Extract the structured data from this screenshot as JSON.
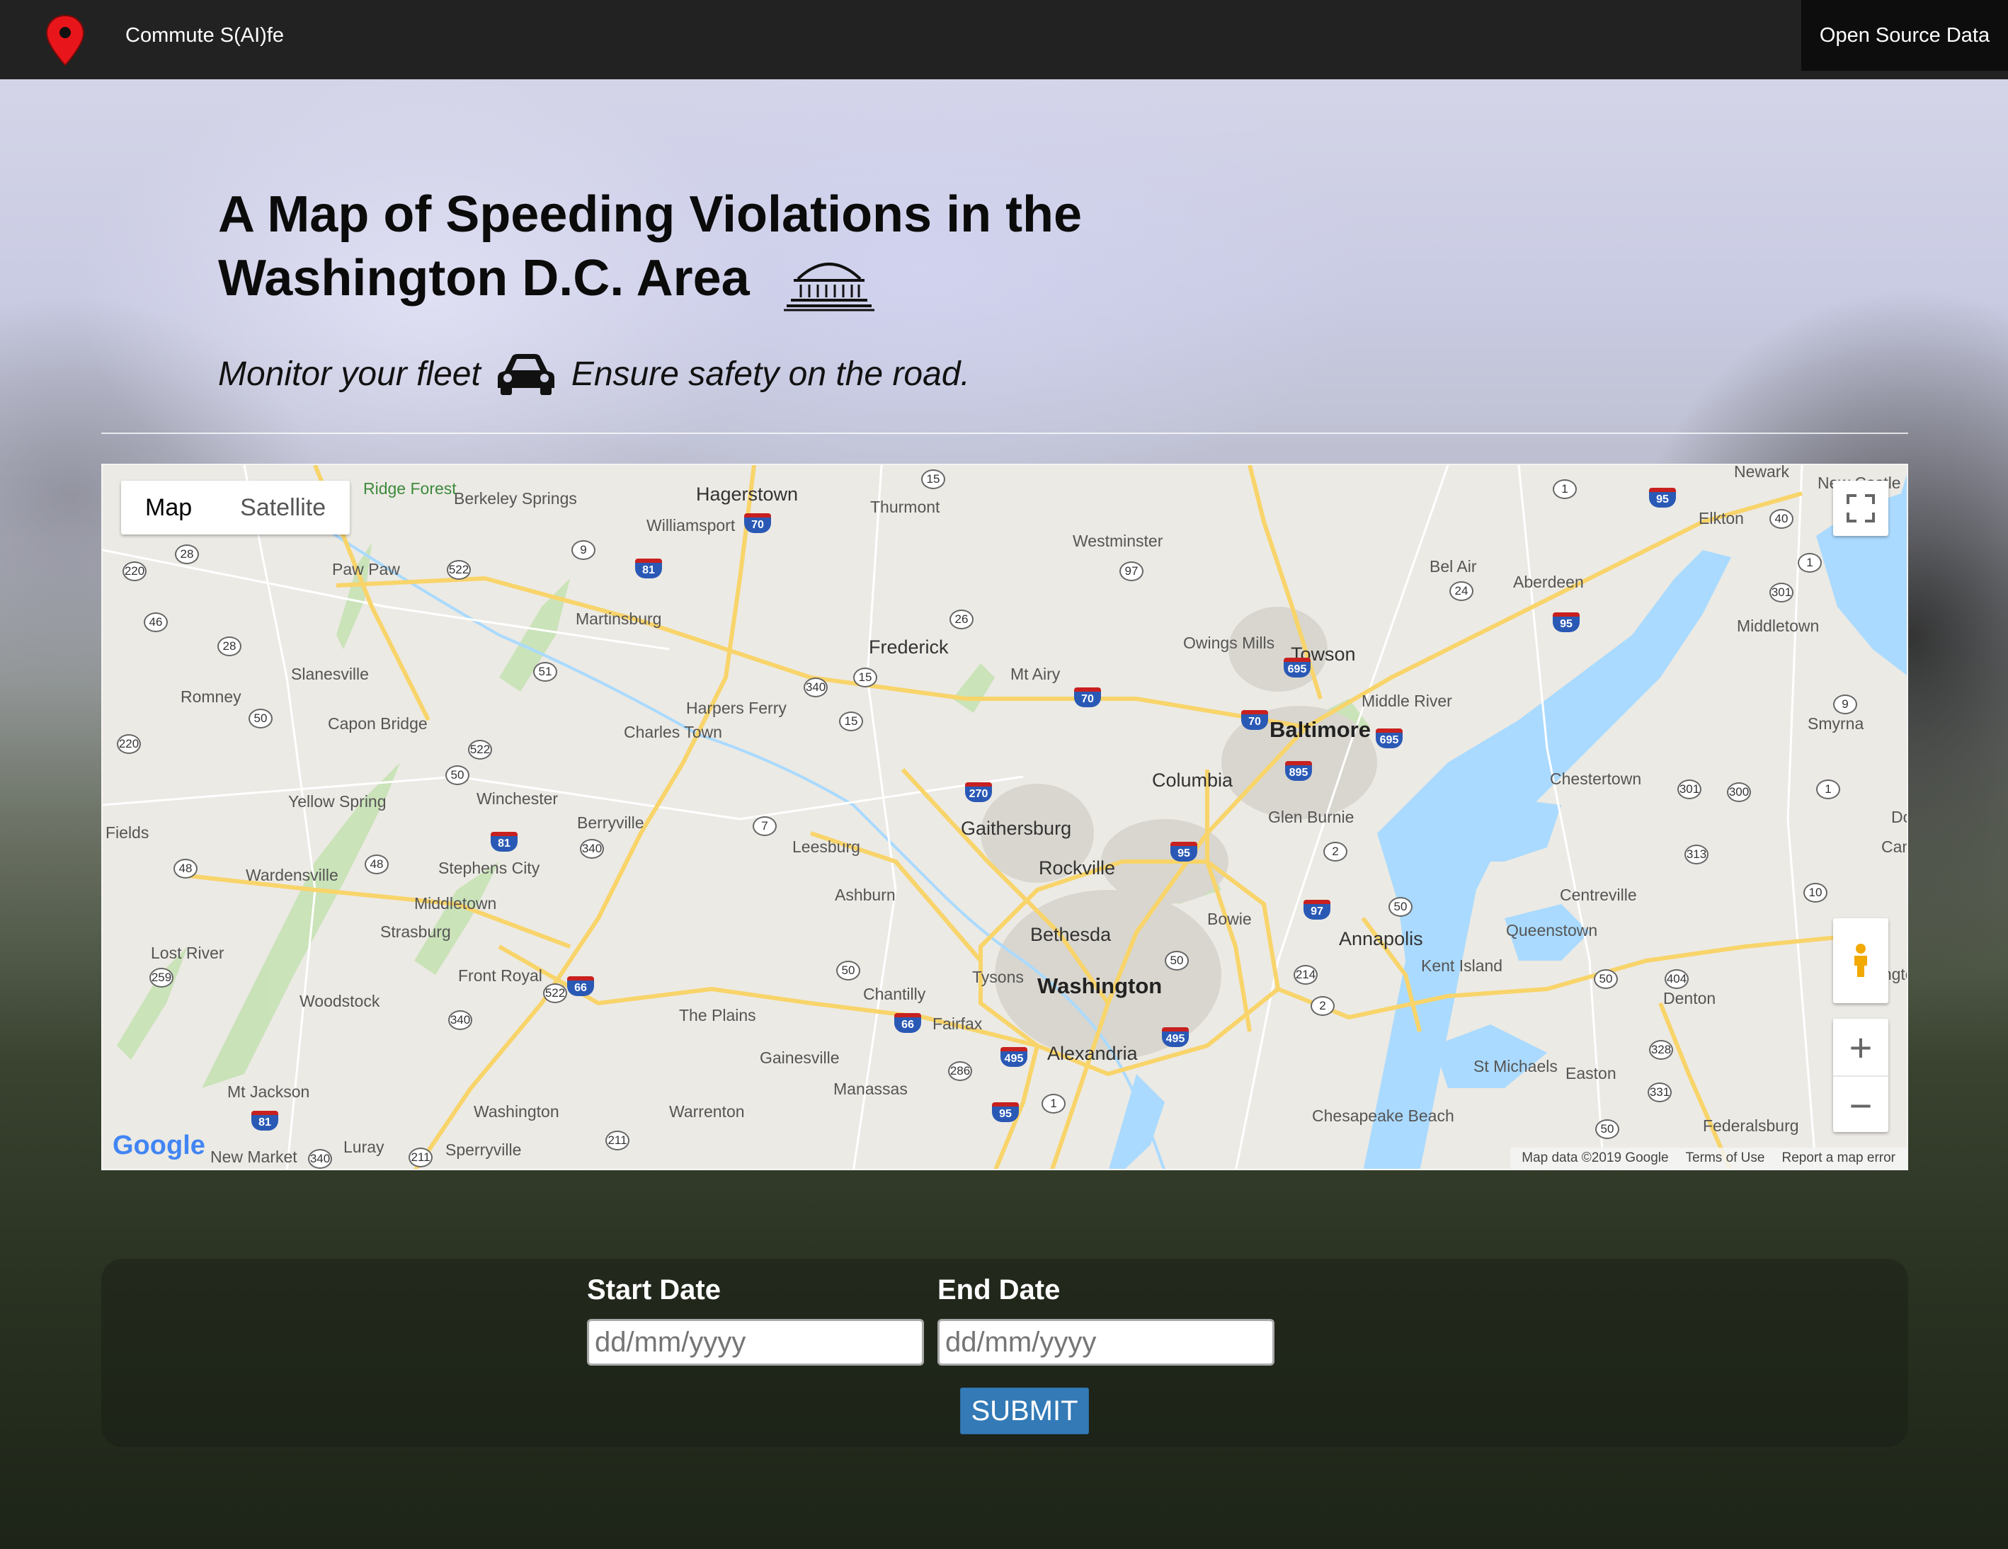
{
  "nav": {
    "brand": "Commute S(AI)fe",
    "right_link": "Open Source Data"
  },
  "hero": {
    "title_line1": "A Map of Speeding Violations in the",
    "title_line2": "Washington D.C. Area",
    "sub_left": "Monitor your fleet",
    "sub_right": "Ensure safety on the road."
  },
  "map": {
    "type_map": "Map",
    "type_satellite": "Satellite",
    "google": "Google",
    "attribution": {
      "data": "Map data ©2019 Google",
      "terms": "Terms of Use",
      "report": "Report a map error"
    },
    "places_major": [
      "Washington",
      "Baltimore"
    ],
    "places_big": [
      "Hagerstown",
      "Frederick",
      "Columbia",
      "Gaithersburg",
      "Rockville",
      "Bethesda",
      "Alexandria",
      "Annapolis",
      "Towson",
      "Winchester",
      "Chestertown",
      "Dover"
    ],
    "places": [
      "Berkeley Springs",
      "Williamsport",
      "Thurmont",
      "Westminster",
      "Bel Air",
      "Aberdeen",
      "Elkton",
      "Middletown",
      "Paw Paw",
      "Martinsburg",
      "Slanesville",
      "Romney",
      "Capon Bridge",
      "Harpers Ferry",
      "Charles Town",
      "Mt Airy",
      "Owings Mills",
      "Middle River",
      "Smyrna",
      "Yellow Spring",
      "Berryville",
      "Leesburg",
      "Glen Burnie",
      "Camden",
      "Fields",
      "Wardensville",
      "Stephens City",
      "Ashburn",
      "Bowie",
      "Centreville",
      "Lost River",
      "Strasburg",
      "Front Royal",
      "Tysons",
      "Chantilly",
      "Fairfax",
      "Kent Island",
      "Queenstown",
      "Denton",
      "Harrington",
      "Woodstock",
      "The Plains",
      "Gainesville",
      "Manassas",
      "St Michaels",
      "Easton",
      "Mt Jackson",
      "Warrenton",
      "Chesapeake Beach",
      "Federalsburg",
      "New Market",
      "Luray",
      "Sperryville",
      "Ridge Forest",
      "Newark",
      "New Castle",
      "Washington",
      "Middletown"
    ]
  },
  "form": {
    "start_label": "Start Date",
    "end_label": "End Date",
    "start_placeholder": "dd/mm/yyyy",
    "end_placeholder": "dd/mm/yyyy",
    "submit_label": "SUBMIT"
  },
  "colors": {
    "navbar": "#222222",
    "submit": "#337ab7",
    "map_water": "#aadaff",
    "map_road": "#f8d46a",
    "interstate": "#2a59b5"
  }
}
